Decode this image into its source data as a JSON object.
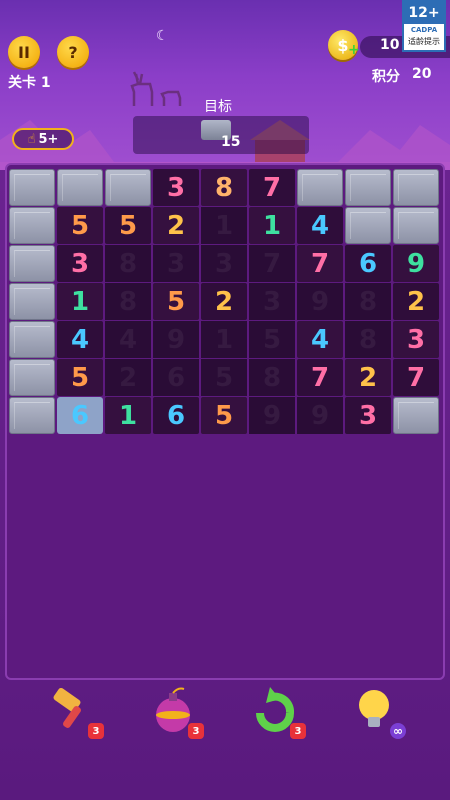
{
  "hud": {
    "pause_label": "II",
    "help_label": "?",
    "coin_symbol": "$",
    "coins": "10",
    "level_label": "关卡 1",
    "score_label": "积分",
    "score_value": "20"
  },
  "age_rating": {
    "rating": "12+",
    "org": "CADPA",
    "note": "适龄提示"
  },
  "goal": {
    "title": "目标",
    "count": "15"
  },
  "hint_pill": {
    "value": "5+"
  },
  "board": {
    "rows": [
      [
        {
          "t": "block"
        },
        {
          "t": "block"
        },
        {
          "t": "block"
        },
        {
          "t": "num",
          "v": "3",
          "c": "#ff6fa6"
        },
        {
          "t": "num",
          "v": "8",
          "c": "#ffb36b"
        },
        {
          "t": "num",
          "v": "7",
          "c": "#ff6fa6"
        },
        {
          "t": "block"
        },
        {
          "t": "block"
        },
        {
          "t": "block"
        }
      ],
      [
        {
          "t": "block"
        },
        {
          "t": "num",
          "v": "5",
          "c": "#ff9a4a"
        },
        {
          "t": "num",
          "v": "5",
          "c": "#ff9a4a"
        },
        {
          "t": "num",
          "v": "2",
          "c": "#ffc24a"
        },
        {
          "t": "used",
          "v": "1"
        },
        {
          "t": "num",
          "v": "1",
          "c": "#3ee0a0"
        },
        {
          "t": "num",
          "v": "4",
          "c": "#4ac8ff"
        },
        {
          "t": "block"
        },
        {
          "t": "block"
        }
      ],
      [
        {
          "t": "block"
        },
        {
          "t": "num",
          "v": "3",
          "c": "#ff6fa6"
        },
        {
          "t": "used",
          "v": "8"
        },
        {
          "t": "used",
          "v": "3"
        },
        {
          "t": "used",
          "v": "3"
        },
        {
          "t": "used",
          "v": "7"
        },
        {
          "t": "num",
          "v": "7",
          "c": "#ff6fa6"
        },
        {
          "t": "num",
          "v": "6",
          "c": "#4ac8ff"
        },
        {
          "t": "num",
          "v": "9",
          "c": "#3ee0a0"
        }
      ],
      [
        {
          "t": "block"
        },
        {
          "t": "num",
          "v": "1",
          "c": "#3ee0a0"
        },
        {
          "t": "used",
          "v": "8"
        },
        {
          "t": "num",
          "v": "5",
          "c": "#ff9a4a"
        },
        {
          "t": "num",
          "v": "2",
          "c": "#ffc24a"
        },
        {
          "t": "used",
          "v": "3"
        },
        {
          "t": "used",
          "v": "9"
        },
        {
          "t": "used",
          "v": "8"
        },
        {
          "t": "num",
          "v": "2",
          "c": "#ffc24a"
        }
      ],
      [
        {
          "t": "block"
        },
        {
          "t": "num",
          "v": "4",
          "c": "#4ac8ff"
        },
        {
          "t": "used",
          "v": "4"
        },
        {
          "t": "used",
          "v": "9"
        },
        {
          "t": "used",
          "v": "1"
        },
        {
          "t": "used",
          "v": "5"
        },
        {
          "t": "num",
          "v": "4",
          "c": "#4ac8ff"
        },
        {
          "t": "used",
          "v": "8"
        },
        {
          "t": "num",
          "v": "3",
          "c": "#ff6fa6"
        }
      ],
      [
        {
          "t": "block"
        },
        {
          "t": "num",
          "v": "5",
          "c": "#ff9a4a"
        },
        {
          "t": "used",
          "v": "2"
        },
        {
          "t": "used",
          "v": "6"
        },
        {
          "t": "used",
          "v": "5"
        },
        {
          "t": "used",
          "v": "8"
        },
        {
          "t": "num",
          "v": "7",
          "c": "#ff6fa6"
        },
        {
          "t": "num",
          "v": "2",
          "c": "#ffc24a"
        },
        {
          "t": "num",
          "v": "7",
          "c": "#ff6fa6"
        }
      ],
      [
        {
          "t": "block"
        },
        {
          "t": "sel",
          "v": "6",
          "c": "#4ac8ff"
        },
        {
          "t": "num",
          "v": "1",
          "c": "#3ee0a0"
        },
        {
          "t": "num",
          "v": "6",
          "c": "#4ac8ff"
        },
        {
          "t": "num",
          "v": "5",
          "c": "#ff9a4a"
        },
        {
          "t": "used",
          "v": "9"
        },
        {
          "t": "used",
          "v": "9"
        },
        {
          "t": "num",
          "v": "3",
          "c": "#ff6fa6"
        },
        {
          "t": "block"
        }
      ]
    ]
  },
  "tools": [
    {
      "name": "hammer-icon",
      "count": "3"
    },
    {
      "name": "bomb-icon",
      "count": "3"
    },
    {
      "name": "refresh-icon",
      "count": "3"
    },
    {
      "name": "lightbulb-icon",
      "count": "∞"
    }
  ]
}
